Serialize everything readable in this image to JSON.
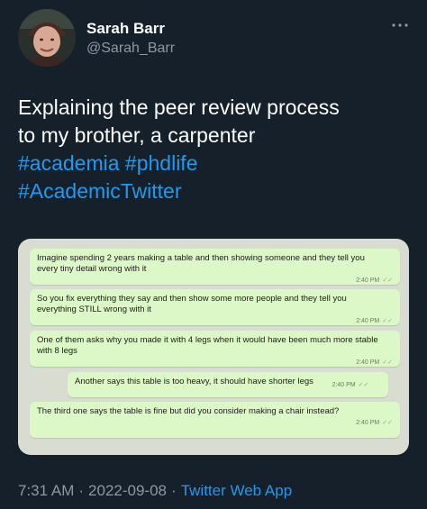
{
  "author": {
    "display_name": "Sarah Barr",
    "handle": "@Sarah_Barr"
  },
  "tweet": {
    "text_line1": "Explaining the peer review process",
    "text_line2": "to my brother, a carpenter",
    "hashtags": [
      "#academia",
      "#phdlife",
      "#AcademicTwitter"
    ]
  },
  "chat": {
    "messages": [
      {
        "text": "Imagine spending 2 years making a table and then showing someone and they tell you every tiny detail wrong with it",
        "time": "2:40 PM"
      },
      {
        "text": "So you fix everything they say and then show some more people and they tell you everything STILL wrong with it",
        "time": "2:40 PM"
      },
      {
        "text": "One of them asks why you made it with 4 legs when it would have been much more stable with 8 legs",
        "time": "2:40 PM"
      },
      {
        "text": "Another says this table is too heavy, it should have shorter legs",
        "time": "2:40 PM"
      },
      {
        "text": "The third one says the table is fine but did you consider making a chair instead?",
        "time": "2:40 PM"
      }
    ]
  },
  "footer": {
    "time": "7:31 AM",
    "separator": "·",
    "date": "2022-09-08",
    "source": "Twitter Web App"
  },
  "icons": {
    "more": "more-dots-icon",
    "read_receipt": "double-check-icon"
  },
  "colors": {
    "background": "#15202b",
    "link": "#1d9bf0",
    "secondary_text": "#8b98a5",
    "bubble": "#dcf8c6",
    "chat_background": "#d9dcd1"
  }
}
